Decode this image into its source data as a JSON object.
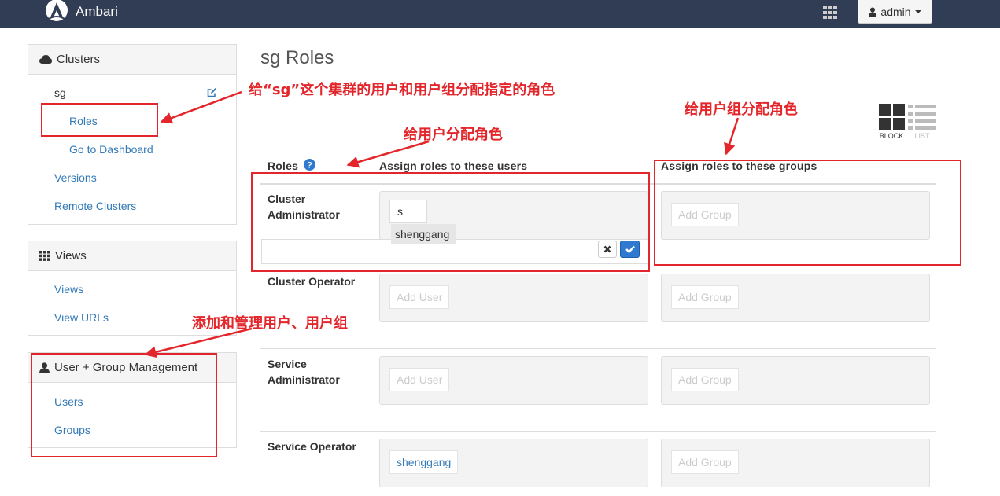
{
  "navbar": {
    "brand": "Ambari",
    "user_label": "admin",
    "icons": {
      "logo": "ambari-logo-icon",
      "apps": "grid-icon",
      "user": "user-icon"
    }
  },
  "sidebar": {
    "clusters": {
      "header": "Clusters",
      "cluster_name": "sg",
      "items": [
        "Roles",
        "Go to Dashboard",
        "Versions",
        "Remote Clusters"
      ]
    },
    "views": {
      "header": "Views",
      "items": [
        "Views",
        "View URLs"
      ]
    },
    "users": {
      "header": "User + Group Management",
      "items": [
        "Users",
        "Groups"
      ]
    }
  },
  "main": {
    "title": "sg Roles",
    "view_toggle": [
      "BLOCK",
      "LIST"
    ],
    "columns": [
      "Roles",
      "Assign roles to these users",
      "Assign roles to these groups"
    ],
    "placeholders": {
      "user": "Add User",
      "group": "Add Group"
    },
    "roles": [
      "Cluster Administrator",
      "Cluster Operator",
      "Service Administrator",
      "Service Operator"
    ],
    "editing": {
      "typed_value": "s",
      "suggestion": "shenggang"
    },
    "assigned_user_service_operator": "shenggang"
  },
  "annotations": {
    "cluster_roles": "给“sg”这个集群的用户和用户组分配指定的角色",
    "assign_users": "给用户分配角色",
    "assign_groups": "给用户组分配角色",
    "manage_users": "添加和管理用户、用户组"
  },
  "colors": {
    "navbar": "#313d54",
    "link": "#337ab7",
    "annotation": "#e3262b",
    "confirm_button": "#2f7ad0"
  }
}
